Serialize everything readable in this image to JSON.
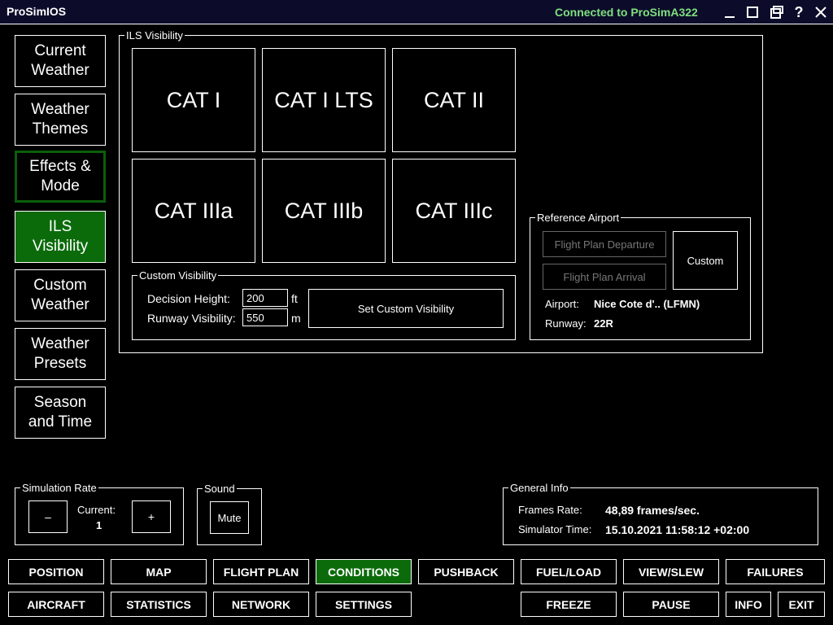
{
  "window": {
    "title": "ProSimIOS",
    "connection": "Connected to ProSimA322"
  },
  "sidebar": {
    "items": [
      {
        "label": "Current\nWeather"
      },
      {
        "label": "Weather\nThemes"
      },
      {
        "label": "Effects &\nMode"
      },
      {
        "label": "ILS\nVisibility"
      },
      {
        "label": "Custom\nWeather"
      },
      {
        "label": "Weather\nPresets"
      },
      {
        "label": "Season\nand Time"
      }
    ]
  },
  "ils": {
    "title": "ILS Visibility",
    "cats": [
      "CAT I",
      "CAT I LTS",
      "CAT II",
      "CAT IIIa",
      "CAT IIIb",
      "CAT IIIc"
    ],
    "custom": {
      "title": "Custom Visibility",
      "dh_label": "Decision Height:",
      "dh_value": "200",
      "dh_unit": "ft",
      "rvr_label": "Runway Visibility:",
      "rvr_value": "550",
      "rvr_unit": "m",
      "set_button": "Set Custom Visibility"
    },
    "reference": {
      "title": "Reference Airport",
      "departure": "Flight Plan Departure",
      "arrival": "Flight Plan Arrival",
      "custom": "Custom",
      "airport_label": "Airport:",
      "airport_value": "Nice Cote d'.. (LFMN)",
      "runway_label": "Runway:",
      "runway_value": "22R"
    }
  },
  "simrate": {
    "title": "Simulation Rate",
    "minus": "–",
    "plus": "+",
    "current_label": "Current:",
    "current_value": "1"
  },
  "sound": {
    "title": "Sound",
    "mute": "Mute"
  },
  "general": {
    "title": "General Info",
    "fps_label": "Frames Rate:",
    "fps_value": "48,89 frames/sec.",
    "time_label": "Simulator Time:",
    "time_value": "15.10.2021 11:58:12 +02:00"
  },
  "nav": {
    "row1": [
      "POSITION",
      "MAP",
      "FLIGHT PLAN",
      "CONDITIONS",
      "PUSHBACK",
      "FUEL/LOAD",
      "VIEW/SLEW",
      "FAILURES"
    ],
    "row2": [
      "AIRCRAFT",
      "STATISTICS",
      "NETWORK",
      "SETTINGS",
      "FREEZE",
      "PAUSE",
      "INFO",
      "EXIT"
    ]
  },
  "colors": {
    "accent": "#0b6b0b",
    "connected": "#7fe07f"
  }
}
